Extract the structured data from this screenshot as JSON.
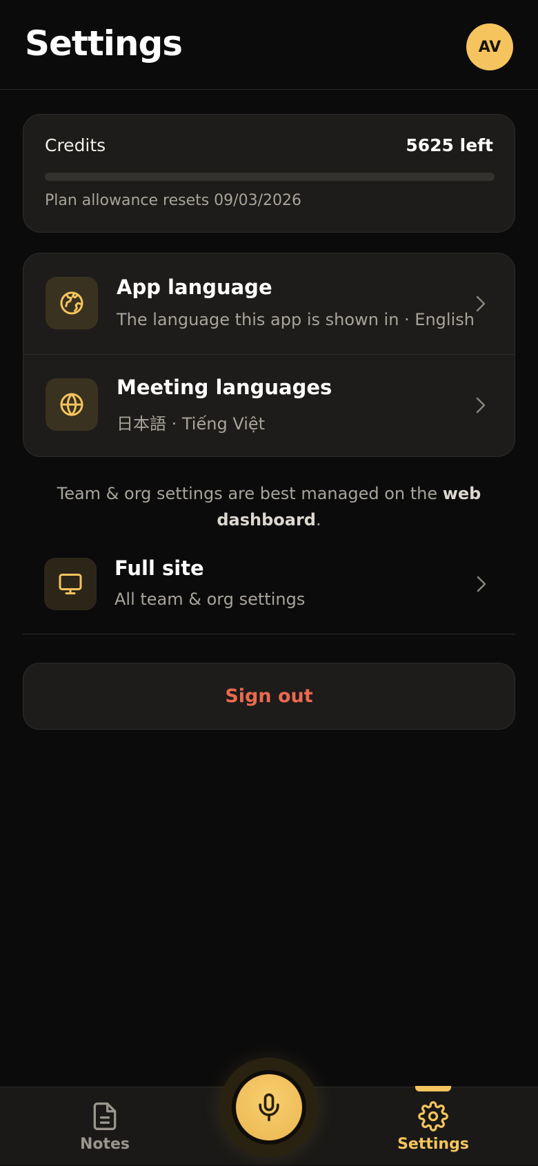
{
  "header": {
    "title": "Settings",
    "avatar_initials": "AV"
  },
  "credits": {
    "label": "Credits",
    "remaining": "5625 left",
    "progress_used_fraction": 0.0,
    "reset_text": "Plan allowance resets 09/03/2026"
  },
  "languages": {
    "items": [
      {
        "title": "App language",
        "subtitle": "The language this app is shown in · English",
        "icon": "globe-africa-icon"
      },
      {
        "title": "Meeting languages",
        "subtitle": "日本語 · Tiếng Việt",
        "icon": "globe-icon"
      }
    ]
  },
  "note": {
    "prefix": "Team & org settings are best managed on the ",
    "link": "web dashboard",
    "suffix": "."
  },
  "full_site": {
    "title": "Full site",
    "subtitle": "All team & org settings",
    "icon": "monitor-icon"
  },
  "signout": {
    "label": "Sign out"
  },
  "nav": {
    "notes_label": "Notes",
    "settings_label": "Settings",
    "active": "Settings"
  },
  "colors": {
    "accent": "#f5c45e",
    "danger": "#ea6a4f",
    "background": "#0b0b0c",
    "card": "#1d1c1a"
  }
}
